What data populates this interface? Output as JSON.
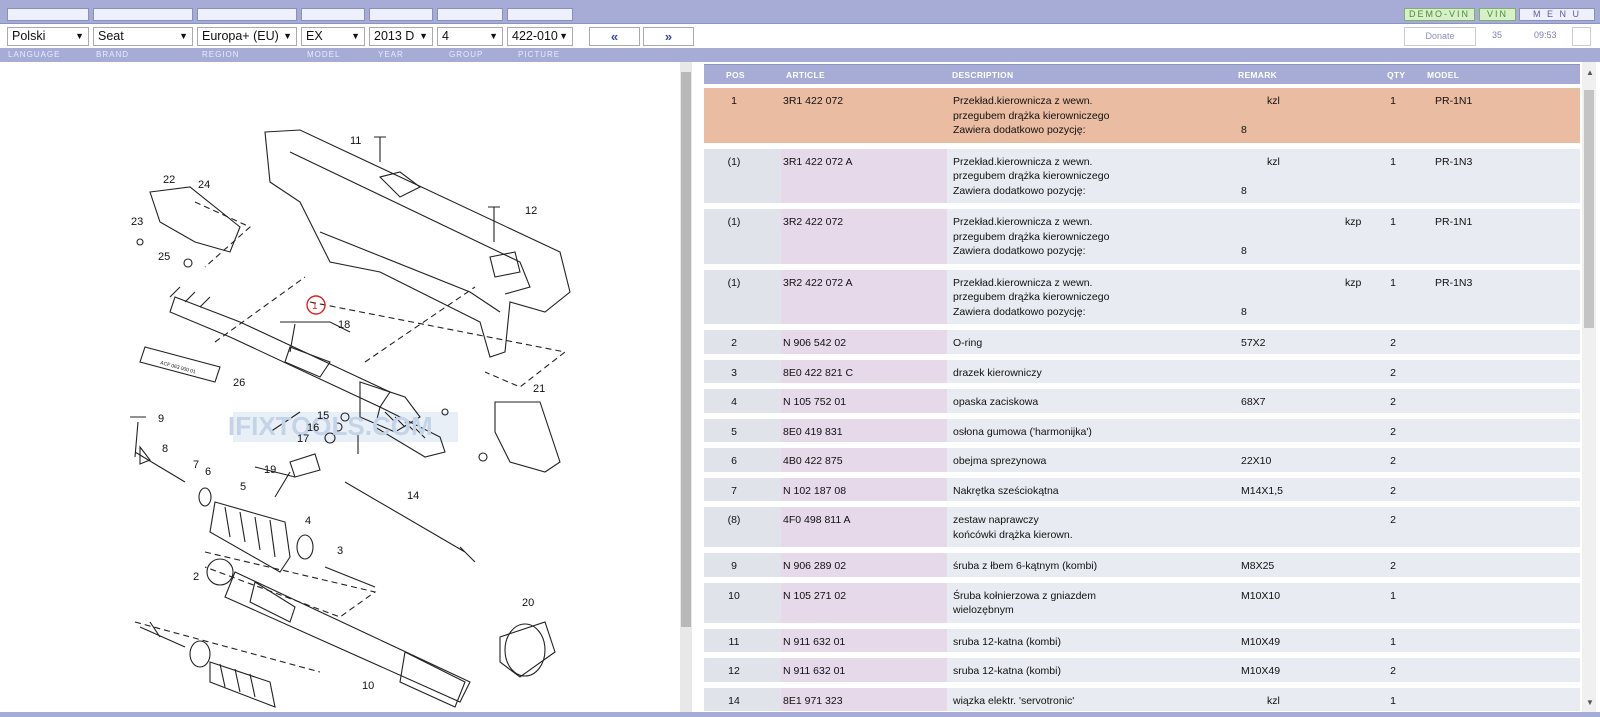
{
  "topbar": {
    "demo_vin": "DEMO-VIN",
    "vin": "VIN",
    "menu": "M E N U"
  },
  "selectors": {
    "language": "Polski",
    "brand": "Seat",
    "region": "Europa+ (EU)",
    "model": "EX",
    "year": "2013  D",
    "group": "4",
    "picture": "422-010",
    "prev": "«",
    "next": "»",
    "donate": "Donate",
    "count": "35",
    "time": "09:53"
  },
  "labels": {
    "language": "LANGUAGE",
    "brand": "BRAND",
    "region": "REGION",
    "model": "MODEL",
    "year": "YEAR",
    "group": "GROUP",
    "picture": "PICTURE"
  },
  "diagram": {
    "watermark": "IFIXTOOLS.COM",
    "callouts": [
      "1",
      "2",
      "3",
      "4",
      "5",
      "6",
      "7",
      "8",
      "9",
      "10",
      "11",
      "12",
      "14",
      "15",
      "16",
      "17",
      "18",
      "19",
      "20",
      "21",
      "22",
      "23",
      "24",
      "25",
      "26"
    ],
    "boot_text": "ACF 063 000 01"
  },
  "table": {
    "headers": {
      "pos": "POS",
      "article": "ARTICLE",
      "description": "DESCRIPTION",
      "remark": "REMARK",
      "qty": "QTY",
      "model": "MODEL"
    },
    "rows": [
      {
        "pos": "1",
        "article": "3R1 422 072",
        "desc": [
          "Przekład.kierownicza z wewn.",
          "przegubem drążka kierowniczego",
          "Zawiera dodatkowo pozycję:"
        ],
        "remark": [
          "kzl",
          "",
          "8"
        ],
        "qty": "1",
        "model": "PR-1N1",
        "highlight": true
      },
      {
        "pos": "(1)",
        "article": "3R1 422 072 A",
        "desc": [
          "Przekład.kierownicza z wewn.",
          "przegubem drążka kierowniczego",
          "Zawiera dodatkowo pozycję:"
        ],
        "remark": [
          "kzl",
          "",
          "8"
        ],
        "qty": "1",
        "model": "PR-1N3",
        "highlight": false
      },
      {
        "pos": "(1)",
        "article": "3R2 422 072",
        "desc": [
          "Przekład.kierownicza z wewn.",
          "przegubem drążka kierowniczego",
          "Zawiera dodatkowo pozycję:"
        ],
        "remark": [
          "kzp",
          "",
          "8"
        ],
        "qty": "1",
        "model": "PR-1N1",
        "highlight": false
      },
      {
        "pos": "(1)",
        "article": "3R2 422 072 A",
        "desc": [
          "Przekład.kierownicza z wewn.",
          "przegubem drążka kierowniczego",
          "Zawiera dodatkowo pozycję:"
        ],
        "remark": [
          "kzp",
          "",
          "8"
        ],
        "qty": "1",
        "model": "PR-1N3",
        "highlight": false
      },
      {
        "pos": "2",
        "article": "N  906 542 02",
        "desc": [
          "O-ring"
        ],
        "remark": [
          "57X2"
        ],
        "qty": "2",
        "model": "",
        "highlight": false
      },
      {
        "pos": "3",
        "article": "8E0 422 821 C",
        "desc": [
          "drazek kierowniczy"
        ],
        "remark": [
          ""
        ],
        "qty": "2",
        "model": "",
        "highlight": false
      },
      {
        "pos": "4",
        "article": "N  105 752 01",
        "desc": [
          "opaska zaciskowa"
        ],
        "remark": [
          "68X7"
        ],
        "qty": "2",
        "model": "",
        "highlight": false
      },
      {
        "pos": "5",
        "article": "8E0 419 831",
        "desc": [
          "osłona gumowa ('harmonijka')"
        ],
        "remark": [
          ""
        ],
        "qty": "2",
        "model": "",
        "highlight": false
      },
      {
        "pos": "6",
        "article": "4B0 422 875",
        "desc": [
          "obejma sprezynowa"
        ],
        "remark": [
          "22X10"
        ],
        "qty": "2",
        "model": "",
        "highlight": false
      },
      {
        "pos": "7",
        "article": "N  102 187 08",
        "desc": [
          "Nakrętka sześciokątna"
        ],
        "remark": [
          "M14X1,5"
        ],
        "qty": "2",
        "model": "",
        "highlight": false
      },
      {
        "pos": "(8)",
        "article": "4F0 498 811 A",
        "desc": [
          "zestaw naprawczy",
          "końcówki drążka kierown."
        ],
        "remark": [
          ""
        ],
        "qty": "2",
        "model": "",
        "highlight": false
      },
      {
        "pos": "9",
        "article": "N  906 289 02",
        "desc": [
          "śruba z łbem 6-kątnym (kombi)"
        ],
        "remark": [
          "M8X25"
        ],
        "qty": "2",
        "model": "",
        "highlight": false
      },
      {
        "pos": "10",
        "article": "N  105 271 02",
        "desc": [
          "Śruba kołnierzowa z gniazdem",
          "wielozębnym"
        ],
        "remark": [
          "M10X10"
        ],
        "qty": "1",
        "model": "",
        "highlight": false
      },
      {
        "pos": "11",
        "article": "N  911 632 01",
        "desc": [
          "sruba 12-katna (kombi)"
        ],
        "remark": [
          "M10X49"
        ],
        "qty": "1",
        "model": "",
        "highlight": false
      },
      {
        "pos": "12",
        "article": "N  911 632 01",
        "desc": [
          "sruba 12-katna (kombi)"
        ],
        "remark": [
          "M10X49"
        ],
        "qty": "2",
        "model": "",
        "highlight": false
      },
      {
        "pos": "14",
        "article": "8E1 971 323",
        "desc": [
          "wiązka elektr. 'servotronic'"
        ],
        "remark": [
          "kzl"
        ],
        "qty": "1",
        "model": "",
        "highlight": false
      }
    ]
  }
}
